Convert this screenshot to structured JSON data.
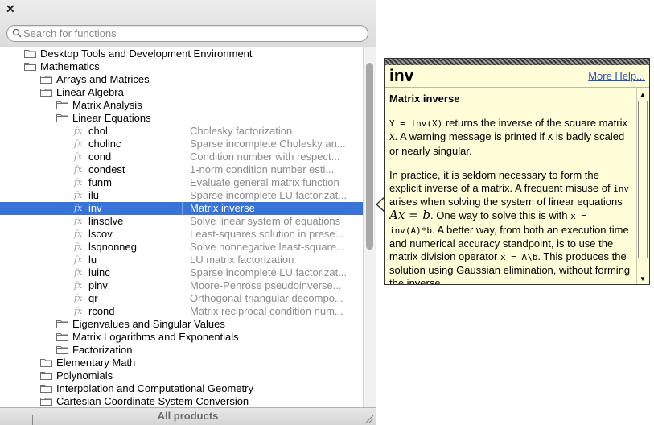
{
  "close_glyph": "✕",
  "search": {
    "placeholder": "Search for functions",
    "value": ""
  },
  "tree": [
    {
      "type": "folder",
      "depth": 1,
      "label": "Desktop Tools and Development Environment"
    },
    {
      "type": "folder",
      "depth": 1,
      "label": "Mathematics",
      "open": true
    },
    {
      "type": "folder",
      "depth": 2,
      "label": "Arrays and Matrices"
    },
    {
      "type": "folder",
      "depth": 2,
      "label": "Linear Algebra",
      "open": true
    },
    {
      "type": "folder",
      "depth": 3,
      "label": "Matrix Analysis"
    },
    {
      "type": "folder",
      "depth": 3,
      "label": "Linear Equations",
      "open": true
    },
    {
      "type": "func",
      "name": "chol",
      "desc": "Cholesky factorization"
    },
    {
      "type": "func",
      "name": "cholinc",
      "desc": "Sparse incomplete Cholesky an..."
    },
    {
      "type": "func",
      "name": "cond",
      "desc": "Condition number with respect..."
    },
    {
      "type": "func",
      "name": "condest",
      "desc": "1-norm condition number esti..."
    },
    {
      "type": "func",
      "name": "funm",
      "desc": "Evaluate general matrix function"
    },
    {
      "type": "func",
      "name": "ilu",
      "desc": "Sparse incomplete LU factorizat..."
    },
    {
      "type": "func",
      "name": "inv",
      "desc": "Matrix inverse",
      "selected": true
    },
    {
      "type": "func",
      "name": "linsolve",
      "desc": "Solve linear system of equations"
    },
    {
      "type": "func",
      "name": "lscov",
      "desc": "Least-squares solution in prese..."
    },
    {
      "type": "func",
      "name": "lsqnonneg",
      "desc": "Solve nonnegative least-square..."
    },
    {
      "type": "func",
      "name": "lu",
      "desc": "LU matrix factorization"
    },
    {
      "type": "func",
      "name": "luinc",
      "desc": "Sparse incomplete LU factorizat..."
    },
    {
      "type": "func",
      "name": "pinv",
      "desc": "Moore-Penrose pseudoinverse..."
    },
    {
      "type": "func",
      "name": "qr",
      "desc": "Orthogonal-triangular decompo..."
    },
    {
      "type": "func",
      "name": "rcond",
      "desc": "Matrix reciprocal condition num..."
    },
    {
      "type": "folder",
      "depth": 3,
      "label": "Eigenvalues and Singular Values"
    },
    {
      "type": "folder",
      "depth": 3,
      "label": "Matrix Logarithms and Exponentials"
    },
    {
      "type": "folder",
      "depth": 3,
      "label": "Factorization"
    },
    {
      "type": "folder",
      "depth": 2,
      "label": "Elementary Math"
    },
    {
      "type": "folder",
      "depth": 2,
      "label": "Polynomials"
    },
    {
      "type": "folder",
      "depth": 2,
      "label": "Interpolation and Computational Geometry"
    },
    {
      "type": "folder",
      "depth": 2,
      "label": "Cartesian Coordinate System Conversion"
    }
  ],
  "footer": {
    "all_products": "All products"
  },
  "help": {
    "title": "inv",
    "more_help": "More Help...",
    "subtitle": "Matrix inverse",
    "p1": {
      "c1": "Y = inv(X)",
      "t1": " returns the inverse of the square matrix ",
      "c2": "X",
      "t2": ". A warning message is printed if ",
      "c3": "X",
      "t3": " is badly scaled or nearly singular."
    },
    "p2": {
      "t1": "In practice, it is seldom necessary to form the explicit inverse of a matrix. A frequent misuse of ",
      "c1": "inv",
      "t2": " arises when solving the system of linear equations ",
      "m1": "Ax = b",
      "t3": ". One way to solve this is with ",
      "c2": "x = inv(A)*b",
      "t4": ". A better way, from both an execution time and numerical accuracy standpoint, is to use the matrix division operator ",
      "c3": "x = A\\b",
      "t5": ". This produces the solution using Gaussian elimination, without forming the inverse."
    }
  },
  "colors": {
    "selection": "#3874d8",
    "popup_bg": "#fffed8",
    "link": "#1c4fd6"
  }
}
